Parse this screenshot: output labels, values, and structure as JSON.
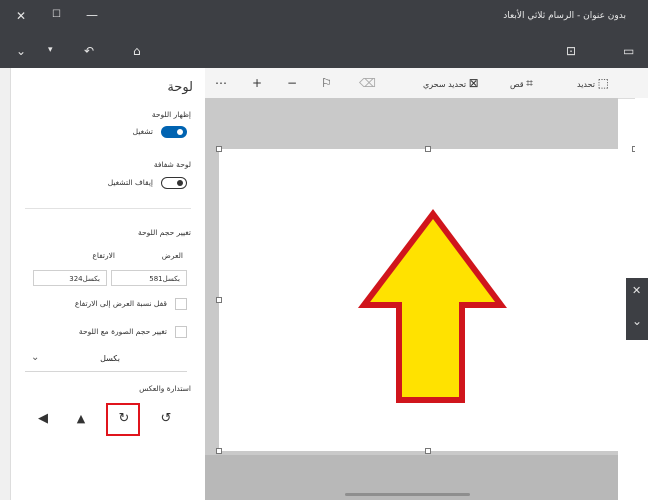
{
  "window": {
    "title": "بدون عنوان - الرسام ثلاثي الأبعاد",
    "titlebar_icons": [
      "close-icon",
      "maximize-icon",
      "minimize-icon"
    ],
    "quickbar_icons": [
      "menu-chevron-icon",
      "dropdown-icon",
      "undo-icon",
      "history-icon",
      "paste-icon",
      "window-icon"
    ]
  },
  "ribbon": {
    "select_label": "تحديد",
    "crop_label": "قص",
    "magic_select_label": "تحديد سحري",
    "more_icon": "ellipsis-icon",
    "zoom_in_icon": "plus-icon",
    "zoom_out_icon": "minus-icon",
    "colors": {
      "bar": "#f4f4f4"
    }
  },
  "panel": {
    "title": "لوحة",
    "show_canvas_label": "إظهار اللوحة",
    "show_canvas_toggle": "تشغيل",
    "show_canvas_on": true,
    "transparent_canvas_label": "لوحة شفافة",
    "transparent_canvas_toggle": "إيقاف التشغيل",
    "transparent_canvas_on": false,
    "resize_label": "تغيير حجم اللوحة",
    "width_label": "العرض",
    "height_label": "الارتفاع",
    "width_value": "581بكسل",
    "height_value": "324بكسل",
    "lock_aspect_label": "قفل نسبة العرض إلى الارتفاع",
    "resize_image_label": "تغيير حجم الصورة مع اللوحة",
    "units_value": "بكسل",
    "rotate_flip_label": "استدارة والعكس",
    "flip_buttons": [
      "flip-horizontal-icon",
      "flip-vertical-icon",
      "rotate-right-icon",
      "rotate-left-icon"
    ],
    "highlighted_button": "rotate-right-icon"
  },
  "canvas": {
    "shape": "arrow-up",
    "fill_color": "#ffe200",
    "stroke_color": "#d0151c"
  },
  "colors": {
    "dark_bar": "#3d3f44",
    "accent": "#0063b1",
    "highlight": "#e0141c"
  }
}
